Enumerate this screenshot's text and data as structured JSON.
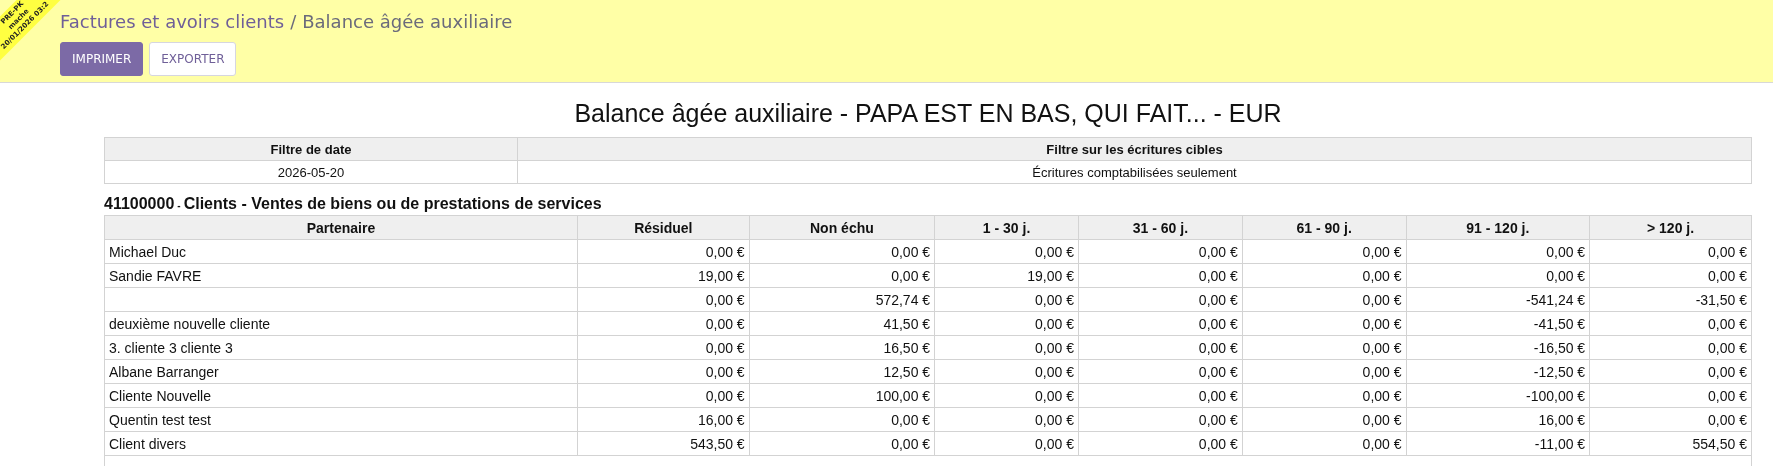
{
  "breadcrumb": [
    {
      "label": "Factures et avoirs clients",
      "current": false
    },
    {
      "label": "Balance âgée auxiliaire",
      "current": true
    }
  ],
  "separator": "/",
  "buttons": [
    {
      "label": "IMPRIMER",
      "kind": "primary"
    },
    {
      "label": "EXPORTER",
      "kind": "secondary"
    }
  ],
  "ribbon": {
    "lines": [
      "PRE-PK",
      "mache",
      "20/01/2026 03:2"
    ]
  },
  "report_title": "Balance âgée auxiliaire - PAPA EST EN BAS, QUI FAIT... - EUR",
  "filters": {
    "columns": [
      "Filtre de date",
      "Filtre sur les écritures cibles"
    ],
    "values": [
      "2026-05-20",
      "Écritures comptabilisées seulement"
    ]
  },
  "account": {
    "code": "41100000",
    "separator": "-",
    "name": "Clients - Ventes de biens ou de prestations de services"
  },
  "table": {
    "columns": [
      "Partenaire",
      "Résiduel",
      "Non échu",
      "1 - 30 j.",
      "31 - 60 j.",
      "61 - 90 j.",
      "91 - 120 j.",
      "> 120 j."
    ],
    "rows": [
      {
        "partner": "Michael Duc",
        "amounts": [
          "0,00 €",
          "0,00 €",
          "0,00 €",
          "0,00 €",
          "0,00 €",
          "0,00 €",
          "0,00 €"
        ]
      },
      {
        "partner": "Sandie FAVRE",
        "amounts": [
          "19,00 €",
          "0,00 €",
          "19,00 €",
          "0,00 €",
          "0,00 €",
          "0,00 €",
          "0,00 €"
        ]
      },
      {
        "amounts": [
          "0,00 €",
          "572,74 €",
          "0,00 €",
          "0,00 €",
          "0,00 €",
          "-541,24 €",
          "-31,50 €"
        ]
      },
      {
        "partner": "deuxième nouvelle cliente",
        "amounts": [
          "0,00 €",
          "41,50 €",
          "0,00 €",
          "0,00 €",
          "0,00 €",
          "-41,50 €",
          "0,00 €"
        ]
      },
      {
        "partner": "3. cliente 3 cliente 3",
        "amounts": [
          "0,00 €",
          "16,50 €",
          "0,00 €",
          "0,00 €",
          "0,00 €",
          "-16,50 €",
          "0,00 €"
        ]
      },
      {
        "partner": "Albane Barranger",
        "amounts": [
          "0,00 €",
          "12,50 €",
          "0,00 €",
          "0,00 €",
          "0,00 €",
          "-12,50 €",
          "0,00 €"
        ]
      },
      {
        "partner": "Cliente Nouvelle",
        "amounts": [
          "0,00 €",
          "100,00 €",
          "0,00 €",
          "0,00 €",
          "0,00 €",
          "-100,00 €",
          "0,00 €"
        ]
      },
      {
        "partner": "Quentin test test",
        "amounts": [
          "16,00 €",
          "0,00 €",
          "0,00 €",
          "0,00 €",
          "0,00 €",
          "16,00 €",
          "0,00 €"
        ]
      },
      {
        "partner": "Client divers",
        "amounts": [
          "543,50 €",
          "0,00 €",
          "0,00 €",
          "0,00 €",
          "0,00 €",
          "-11,00 €",
          "554,50 €"
        ]
      }
    ]
  }
}
